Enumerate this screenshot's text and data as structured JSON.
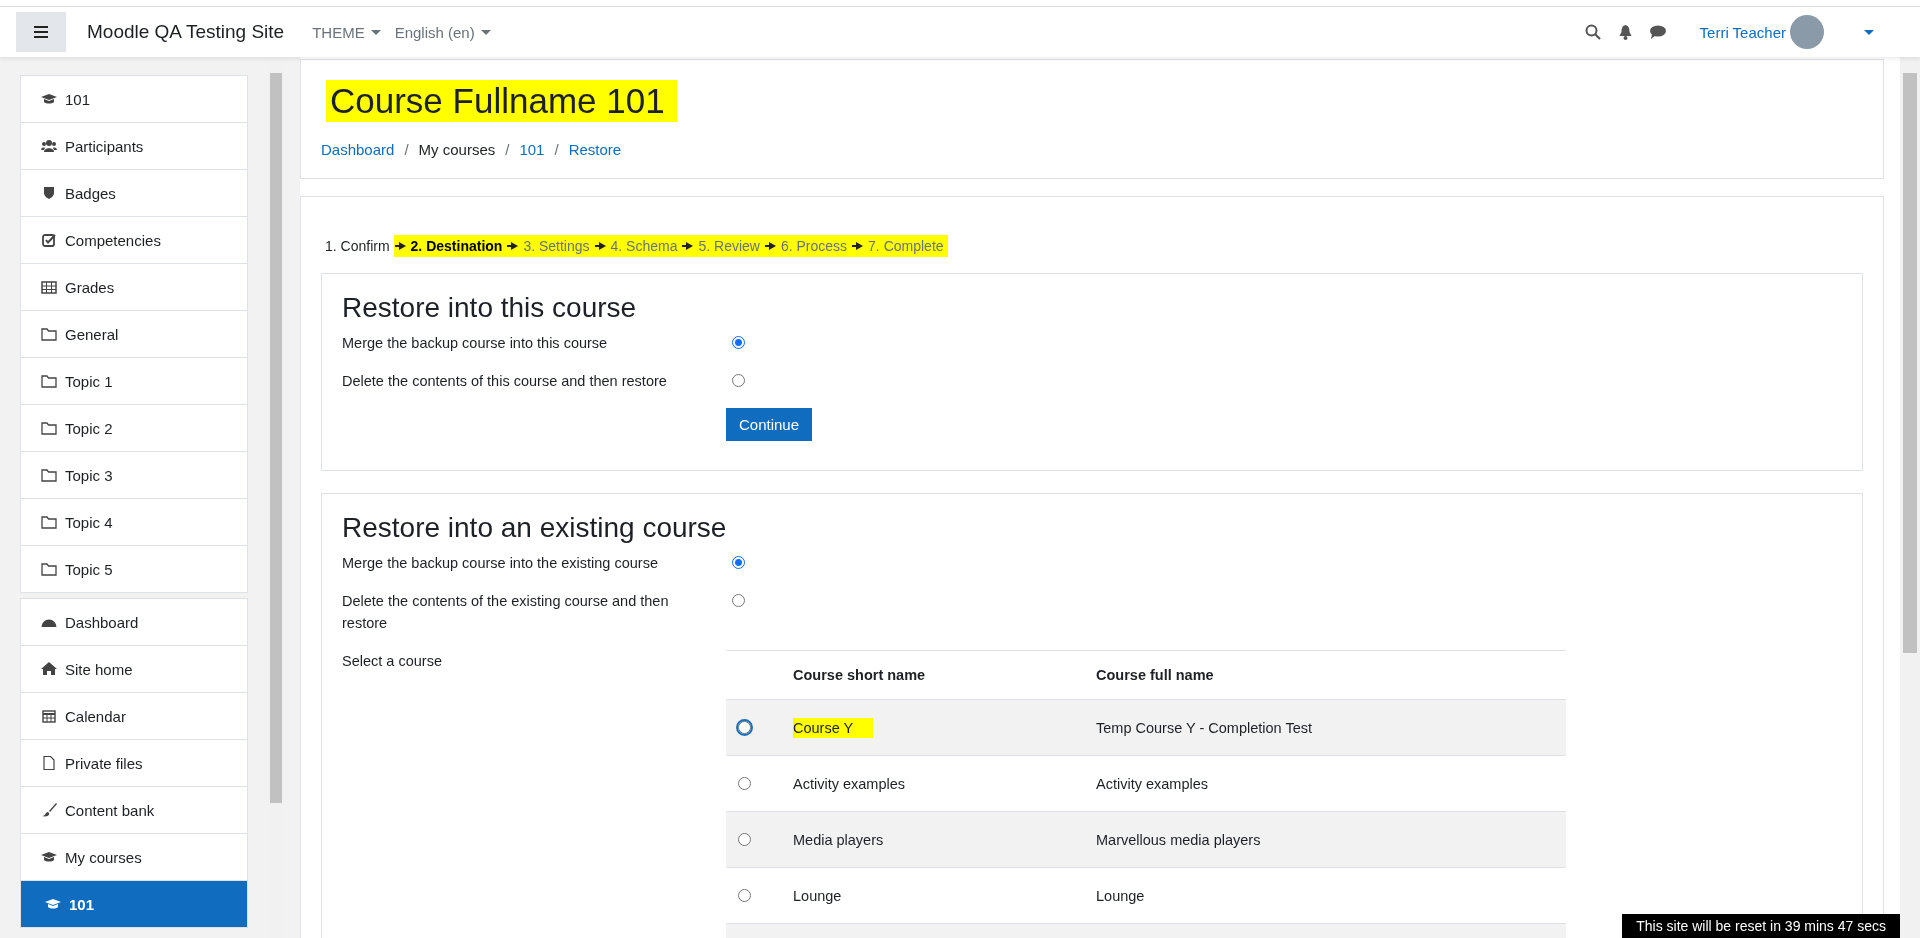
{
  "navbar": {
    "site_name": "Moodle QA Testing Site",
    "menus": [
      {
        "label": "THEME"
      },
      {
        "label": "English (en)"
      }
    ],
    "user_name": "Terri Teacher"
  },
  "sidebar": {
    "groups": [
      {
        "items": [
          {
            "label": "101",
            "selected": false
          },
          {
            "label": "Participants",
            "selected": false
          },
          {
            "label": "Badges",
            "selected": false
          },
          {
            "label": "Competencies",
            "selected": false
          },
          {
            "label": "Grades",
            "selected": false
          },
          {
            "label": "General",
            "selected": false
          },
          {
            "label": "Topic 1",
            "selected": false
          },
          {
            "label": "Topic 2",
            "selected": false
          },
          {
            "label": "Topic 3",
            "selected": false
          },
          {
            "label": "Topic 4",
            "selected": false
          },
          {
            "label": "Topic 5",
            "selected": false
          }
        ]
      },
      {
        "items": [
          {
            "label": "Dashboard",
            "selected": false
          },
          {
            "label": "Site home",
            "selected": false
          },
          {
            "label": "Calendar",
            "selected": false
          },
          {
            "label": "Private files",
            "selected": false
          },
          {
            "label": "Content bank",
            "selected": false
          },
          {
            "label": "My courses",
            "selected": false
          },
          {
            "label": "101",
            "selected": true
          }
        ]
      }
    ]
  },
  "header": {
    "title": "Course Fullname 101",
    "title_highlighted": true,
    "breadcrumb": [
      {
        "label": "Dashboard",
        "link": true
      },
      {
        "separator": "/",
        "label": "My courses",
        "link": false
      },
      {
        "separator": "/",
        "label": "101",
        "link": true
      },
      {
        "separator": "/",
        "label": "Restore",
        "link": true
      }
    ]
  },
  "steps": [
    {
      "label": "1. Confirm",
      "completed": true,
      "selected": false,
      "highlighted": false
    },
    {
      "label": "2. Destination",
      "completed": false,
      "selected": true,
      "highlighted": true
    },
    {
      "label": "3. Settings",
      "completed": false,
      "selected": false,
      "highlighted": true
    },
    {
      "label": "4. Schema",
      "completed": false,
      "selected": false,
      "highlighted": true
    },
    {
      "label": "5. Review",
      "completed": false,
      "selected": false,
      "highlighted": true
    },
    {
      "label": "6. Process",
      "completed": false,
      "selected": false,
      "highlighted": true
    },
    {
      "label": "7. Complete",
      "completed": false,
      "selected": false,
      "highlighted": true
    }
  ],
  "restore_this": {
    "title": "Restore into this course",
    "options": [
      {
        "label": "Merge the backup course into this course",
        "selected": true
      },
      {
        "label": "Delete the contents of this course and then restore",
        "selected": false
      }
    ],
    "button": "Continue"
  },
  "restore_existing": {
    "title": "Restore into an existing course",
    "options": [
      {
        "label": "Merge the backup course into the existing course",
        "selected": true
      },
      {
        "label": "Delete the contents of the existing course and then restore",
        "selected": false
      }
    ],
    "select_label": "Select a course",
    "table": {
      "columns": [
        "Course short name",
        "Course full name"
      ],
      "rows": [
        {
          "short": "Course Y",
          "full": "Temp Course Y - Completion Test",
          "selected": false,
          "highlighted": true
        },
        {
          "short": "Activity examples",
          "full": "Activity examples",
          "selected": false,
          "highlighted": false
        },
        {
          "short": "Media players",
          "full": "Marvellous media players",
          "selected": false,
          "highlighted": false
        },
        {
          "short": "Lounge",
          "full": "Lounge",
          "selected": false,
          "highlighted": false
        }
      ]
    }
  },
  "reset_notice": "This site will be reset in 39 mins 47 secs"
}
